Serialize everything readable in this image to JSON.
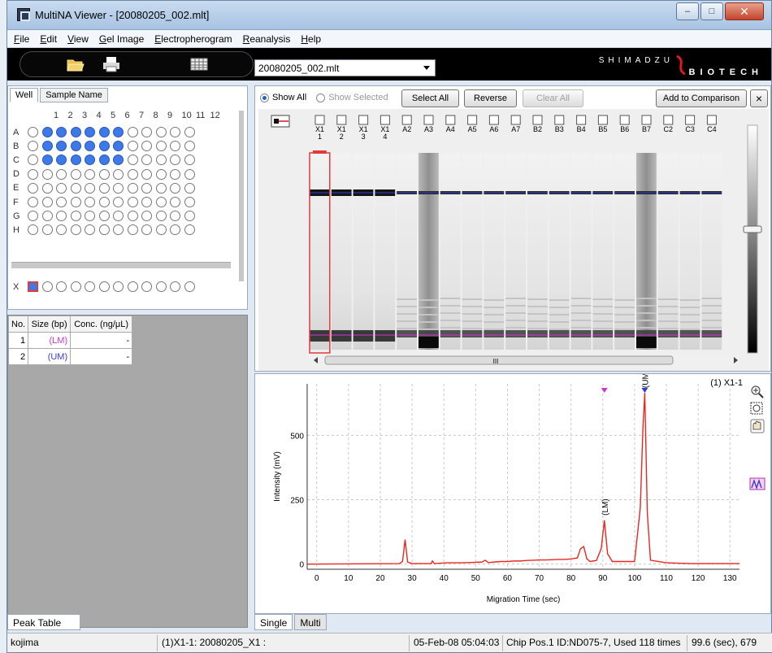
{
  "window": {
    "title": "MultiNA Viewer - [20080205_002.mlt]"
  },
  "menu": {
    "items": [
      {
        "label": "File",
        "key": "F"
      },
      {
        "label": "Edit",
        "key": "E"
      },
      {
        "label": "View",
        "key": "V"
      },
      {
        "label": "Gel Image",
        "key": "G"
      },
      {
        "label": "Electropherogram",
        "key": "E"
      },
      {
        "label": "Reanalysis",
        "key": "R"
      },
      {
        "label": "Help",
        "key": "H"
      }
    ]
  },
  "toolbar": {
    "file_select": "20080205_002.mlt",
    "brand_top": "SHIMADZU",
    "brand_bottom": "BIOTECH"
  },
  "well_panel": {
    "tab_well": "Well",
    "tab_sample": "Sample Name",
    "columns": [
      "1",
      "2",
      "3",
      "4",
      "5",
      "6",
      "7",
      "8",
      "9",
      "10",
      "11",
      "12"
    ],
    "rows": [
      "A",
      "B",
      "C",
      "D",
      "E",
      "F",
      "G",
      "H"
    ],
    "filled": {
      "A": [
        2,
        3,
        4,
        5,
        6,
        7
      ],
      "B": [
        2,
        3,
        4,
        5,
        6,
        7
      ],
      "C": [
        2,
        3,
        4,
        5,
        6,
        7
      ]
    },
    "x_row_label": "X"
  },
  "peak_table": {
    "headers": [
      "No.",
      "Size (bp)",
      "Conc. (ng/μL)"
    ],
    "rows": [
      {
        "no": "1",
        "size": "(LM)",
        "conc": "-",
        "color": "#d632d6"
      },
      {
        "no": "2",
        "size": "(UM)",
        "conc": "-",
        "color": "#3a3adf"
      }
    ],
    "tab": "Peak Table"
  },
  "gel": {
    "show_all": "Show All",
    "show_selected": "Show Selected",
    "select_all": "Select All",
    "reverse": "Reverse",
    "clear_all": "Clear All",
    "add_to_comparison": "Add to Comparison",
    "close": "×",
    "lanes": [
      {
        "l1": "X1",
        "l2": "1"
      },
      {
        "l1": "X1",
        "l2": "2"
      },
      {
        "l1": "X1",
        "l2": "3"
      },
      {
        "l1": "X1",
        "l2": "4"
      },
      {
        "l1": "A2",
        "l2": ""
      },
      {
        "l1": "A3",
        "l2": ""
      },
      {
        "l1": "A4",
        "l2": ""
      },
      {
        "l1": "A5",
        "l2": ""
      },
      {
        "l1": "A6",
        "l2": ""
      },
      {
        "l1": "A7",
        "l2": ""
      },
      {
        "l1": "B2",
        "l2": ""
      },
      {
        "l1": "B3",
        "l2": ""
      },
      {
        "l1": "B4",
        "l2": ""
      },
      {
        "l1": "B5",
        "l2": ""
      },
      {
        "l1": "B6",
        "l2": ""
      },
      {
        "l1": "B7",
        "l2": ""
      },
      {
        "l1": "C2",
        "l2": ""
      },
      {
        "l1": "C3",
        "l2": ""
      },
      {
        "l1": "C4",
        "l2": ""
      }
    ],
    "scroll_label": "III"
  },
  "electropherogram": {
    "sample_label": "(1) X1-1",
    "tab_single": "Single",
    "tab_multi": "Multi"
  },
  "chart_data": {
    "type": "line",
    "xlabel": "Migration Time (sec)",
    "ylabel": "Intensity (mV)",
    "xlim": [
      -3,
      133
    ],
    "ylim": [
      -20,
      700
    ],
    "xticks": [
      0,
      10,
      20,
      30,
      40,
      50,
      60,
      70,
      80,
      90,
      100,
      110,
      120,
      130
    ],
    "yticks": [
      0,
      250,
      500
    ],
    "grid": true,
    "line_color": "#e8281f",
    "series": [
      {
        "x": [
          -3,
          26,
          27,
          27.8,
          28.6,
          30,
          36,
          36.4,
          37,
          41,
          45,
          48,
          52,
          53,
          54,
          56,
          58,
          60,
          62,
          64,
          66,
          68,
          70,
          72,
          74,
          76,
          78,
          80,
          82,
          83,
          84,
          85,
          86,
          88,
          89.5,
          90.5,
          91.5,
          93,
          100,
          101.8,
          102.6,
          103.2,
          104,
          105,
          110,
          118,
          133
        ],
        "y": [
          0,
          2,
          10,
          95,
          8,
          2,
          2,
          12,
          2,
          5,
          5,
          6,
          8,
          15,
          6,
          8,
          10,
          10,
          12,
          12,
          14,
          15,
          16,
          16,
          17,
          18,
          18,
          20,
          24,
          60,
          68,
          20,
          10,
          14,
          60,
          170,
          40,
          10,
          10,
          220,
          520,
          665,
          200,
          15,
          5,
          2,
          2
        ]
      }
    ],
    "annotations": [
      {
        "label": "(LM)",
        "x": 90.5,
        "y": 170,
        "color": "#000000"
      },
      {
        "label": "(UM)",
        "x": 103.2,
        "y": 665,
        "color": "#000000"
      }
    ],
    "markers": [
      {
        "x": 90.5,
        "color": "#d632d6"
      },
      {
        "x": 103.2,
        "color": "#2b3fd8"
      }
    ]
  },
  "status": {
    "user": "kojima",
    "sample": "(1)X1-1: 20080205_X1 :",
    "date": "05-Feb-08 05:04:03",
    "chip": "Chip Pos.1 ID:ND075-7, Used 118 times",
    "time": "99.6 (sec), 679"
  }
}
